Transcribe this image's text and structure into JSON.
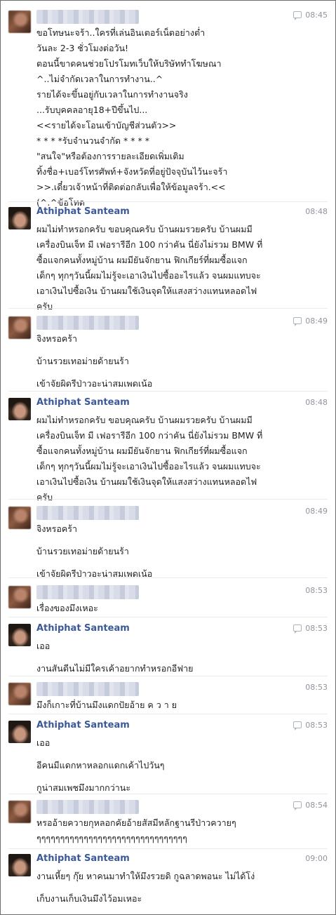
{
  "messages": [
    {
      "sender": "",
      "sender_blurred": true,
      "time": "08:45",
      "show_icon": true,
      "avatar": "blur",
      "lines": [
        "ขอโทษนะจร้า..ใครที่เล่นอินเตอร์เน็ตอย่างต่ำ",
        "วันละ 2-3 ชั่วโมงต่อวัน!",
        "ตอนนี้ขาดคนช่วยโปรโมทเว็บให้บริษัททำโฆษณา",
        "^..ไม่จำกัดเวลาในการทำงาน..^",
        "รายได้จะขึ้นอยู่กับเวลาในการทำงานจริง",
        "...รับบุคคลอายุ18+ปีขึ้นไป...",
        "<<รายได้จะโอนเข้าบัญชีส่วนตัว>>",
        "* * * *รับจำนวนจำกัด * * * *",
        "\"สนใจ\"หรือต้องการรายละเอียดเพิ่มเติม",
        "ทิ้งชื่อ+เบอร์โทรศัพท์+จังหวัดที่อยู่ปัจจุบันไว้นะจร้า",
        ">>.เดี๋ยวเจ้าหน้าที่ติดต่อกลับเพื่อให้ข้อมูลจร้า.<<",
        "(^.^ข้อโทด"
      ]
    },
    {
      "sender": "Athiphat Santeam",
      "sender_blurred": false,
      "time": "08:48",
      "show_icon": false,
      "avatar": "photo",
      "lines": [
        "ผมไม่ทำหรอกครับ ขอบคุณครับ บ้านผมรวยครับ บ้านผมมี",
        "เครื่องบินเจ็ท มี เฟอรารีอีก 100 กว่าคัน นี่ยังไม่รวม BMW ที่",
        "ซื้อแจกคนทั้งหมู่บ้าน ผมมียันจักยาน ฟิกเกียร์ที่ผมซื้อแจก",
        "เด็กๆ ทุกๆวันนี้ผมไม่รู้จะเอาเงินไปซื้ออะไรแล้ว จนผมแทบจะ",
        "เอาเงินไปซื้อเงิน บ้านผมใช้เงินจุดให้แสงสว่างแทนหลอดไฟ",
        "ครับ"
      ]
    },
    {
      "sender": "",
      "sender_blurred": true,
      "time": "08:49",
      "show_icon": true,
      "avatar": "blur",
      "paras": [
        "จิงหรอคร้า",
        "บ้านรวยเทอม่ายด้ายนร้า",
        "เข้าจัยผิดรีป่าวอะน่าสมเพดเน้อ"
      ]
    },
    {
      "sender": "Athiphat Santeam",
      "sender_blurred": false,
      "time": "08:48",
      "show_icon": false,
      "avatar": "photo",
      "lines": [
        "ผมไม่ทำหรอกครับ ขอบคุณครับ บ้านผมรวยครับ บ้านผมมี",
        "เครื่องบินเจ็ท มี เฟอรารีอีก 100 กว่าคัน นี่ยังไม่รวม BMW ที่",
        "ซื้อแจกคนทั้งหมู่บ้าน ผมมียันจักยาน ฟิกเกียร์ที่ผมซื้อแจก",
        "เด็กๆ ทุกๆวันนี้ผมไม่รู้จะเอาเงินไปซื้ออะไรแล้ว จนผมแทบจะ",
        "เอาเงินไปซื้อเงิน บ้านผมใช้เงินจุดให้แสงสว่างแทนหลอดไฟ",
        "ครับ"
      ]
    },
    {
      "sender": "",
      "sender_blurred": true,
      "time": "08:49",
      "show_icon": false,
      "avatar": "blur",
      "paras": [
        "จิงหรอคร้า",
        "บ้านรวยเทอม่ายด้ายนร้า",
        "เข้าจัยผิดรีป่าวอะน่าสมเพดเน้อ"
      ]
    },
    {
      "sender": "",
      "sender_blurred": true,
      "time": "08:53",
      "show_icon": false,
      "avatar": "blur",
      "paras": [
        "เรื่องของมึงเหอะ"
      ]
    },
    {
      "sender": "Athiphat Santeam",
      "sender_blurred": false,
      "time": "08:53",
      "show_icon": true,
      "avatar": "photo",
      "paras": [
        "เออ",
        "งานสันดีนไม่มีใครเค้าอยากทำหรอกอีฟาย"
      ]
    },
    {
      "sender": "",
      "sender_blurred": true,
      "time": "08:53",
      "show_icon": false,
      "avatar": "blur",
      "paras": [
        "มึงก็เกาะที่บ้านมึงแดกปัยอ้าย ค ว า ย"
      ]
    },
    {
      "sender": "Athiphat Santeam",
      "sender_blurred": false,
      "time": "08:53",
      "show_icon": true,
      "avatar": "photo",
      "paras": [
        "เออ",
        "อีคนมีแดกหาหลอกแดกเค้าไปวันๆ",
        "กูน่าสมเพชมึงมากกว่านะ"
      ]
    },
    {
      "sender": "",
      "sender_blurred": true,
      "time": "08:54",
      "show_icon": true,
      "avatar": "blur",
      "lines": [
        "หรออ้ายควายกุหลอกคัยอ้ายสัสมีหลักฐานรีป่าวควายๆ",
        "ๆๆๆๆๆๆๆๆๆๆๆๆๆๆๆๆๆๆๆๆๆๆๆๆๆๆๆๆๆๆๆๆ"
      ]
    },
    {
      "sender": "Athiphat Santeam",
      "sender_blurred": false,
      "time": "09:00",
      "show_icon": false,
      "avatar": "photo",
      "paras": [
        "งานเหี้ยๆ กุ๊ย หาคนมาทำให้มึงรวยดิ กูฉลาดพอนะ ไม่ได้โง่",
        "เก็บงานเก็บเงินมึงไว้อมเหอะ"
      ]
    }
  ]
}
